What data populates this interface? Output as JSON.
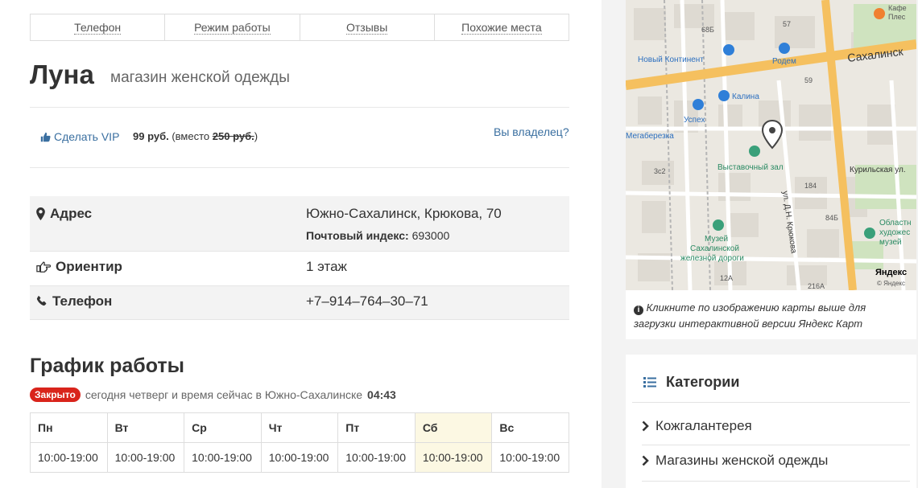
{
  "tabs": [
    "Телефон",
    "Режим работы",
    "Отзывы",
    "Похожие места"
  ],
  "place": {
    "name": "Луна",
    "category": "магазин женской одежды"
  },
  "vip": {
    "label": "Сделать VIP",
    "price": "99 руб.",
    "instead_prefix": "(вместо",
    "old_price": "250 руб.",
    "instead_suffix": ")",
    "owner_link": "Вы владелец?"
  },
  "info": {
    "address_label": "Адрес",
    "address_value": "Южно-Сахалинск, Крюкова, 70",
    "postal_label": "Почтовый индекс:",
    "postal_value": "693000",
    "landmark_label": "Ориентир",
    "landmark_value": "1 этаж",
    "phone_label": "Телефон",
    "phone_value": "+7–914–764–30–71"
  },
  "schedule": {
    "title": "График работы",
    "badge": "Закрыто",
    "status_text": "сегодня четверг и время сейчас в Южно-Сахалинске",
    "time": "04:43",
    "days": [
      "Пн",
      "Вт",
      "Ср",
      "Чт",
      "Пт",
      "Сб",
      "Вс"
    ],
    "hours": [
      "10:00-19:00",
      "10:00-19:00",
      "10:00-19:00",
      "10:00-19:00",
      "10:00-19:00",
      "10:00-19:00",
      "10:00-19:00"
    ]
  },
  "map": {
    "note": "Кликните по изображению карты выше для загрузки интерактивной версии Яндекс Карт",
    "labels": {
      "cafe": "Кафе",
      "cafe2": "Плес",
      "street_sakh": "Сахалинск",
      "rodem": "Родем",
      "new_continent": "Новый Континент",
      "kalina": "Калина",
      "uspekh": "Успех",
      "megaberezka": "Мегаберезка",
      "exhibition": "Выставочный зал",
      "kurilskaya": "Курильская ул.",
      "krukova": "ул. Д.Н. Крюкова",
      "museum_rail_1": "Музей",
      "museum_rail_2": "Сахалинской",
      "museum_rail_3": "железной дороги",
      "art_museum_1": "Областн",
      "art_museum_2": "художес",
      "art_museum_3": "музей",
      "yandex": "Яндекс",
      "copyright": "© Яндекс",
      "n68b": "68Б",
      "n57": "57",
      "n59": "59",
      "n184": "184",
      "n84b": "84Б",
      "n3c2": "3с2",
      "n12a": "12А",
      "n216a": "216А"
    }
  },
  "categories": {
    "title": "Категории",
    "items": [
      "Кожгалантерея",
      "Магазины женской одежды"
    ]
  }
}
